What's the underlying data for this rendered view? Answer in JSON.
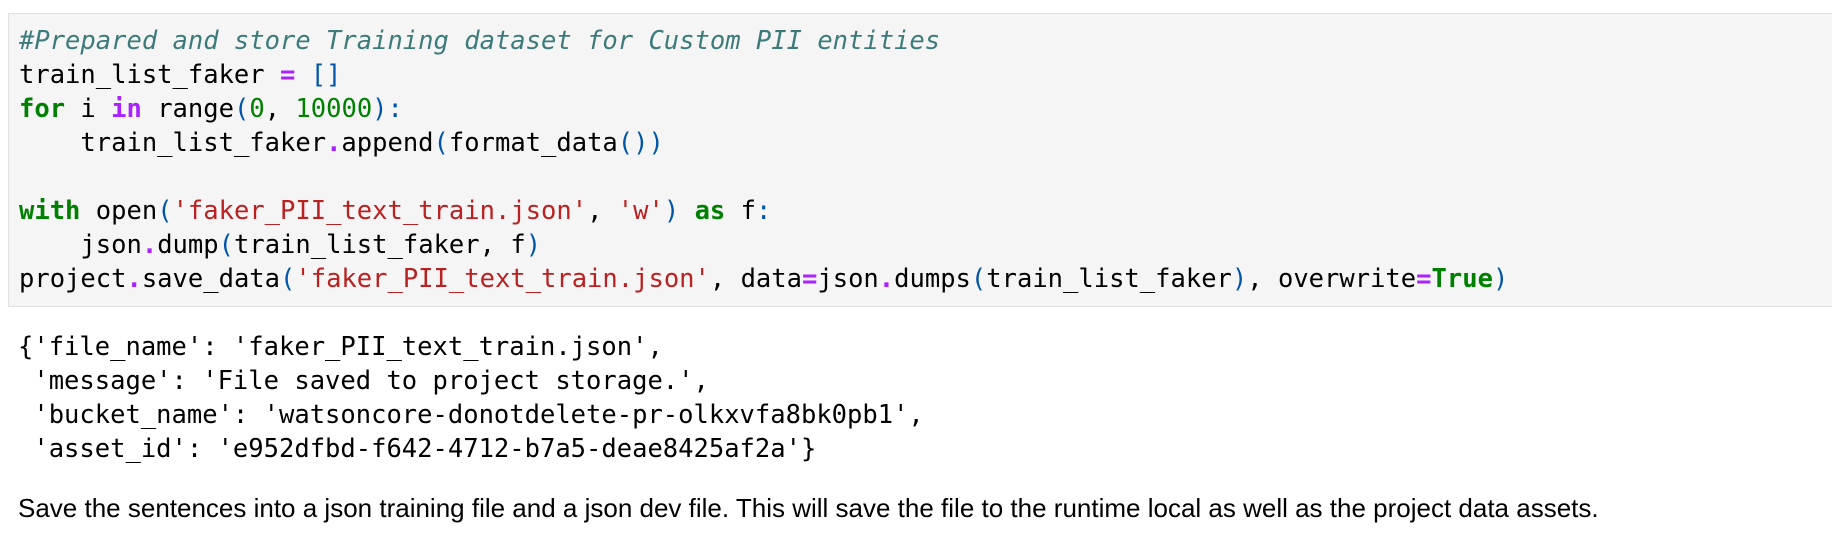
{
  "code_cell": {
    "comment": "#Prepared and store Training dataset for Custom PII entities",
    "l2": {
      "name": "train_list_faker",
      "assign": " = ",
      "value": "[]"
    },
    "l3": {
      "for": "for",
      "var": " i ",
      "in": "in",
      "call": " range",
      "open": "(",
      "n0": "0",
      "sep": ", ",
      "n1": "10000",
      "close": ")",
      "colon": ":"
    },
    "l4": {
      "indent": "    ",
      "obj": "train_list_faker",
      "dot": ".",
      "meth": "append",
      "open": "(",
      "fn": "format_data",
      "paren": "()",
      "close": ")"
    },
    "l6": {
      "with": "with",
      "sp": " ",
      "fn": "open",
      "open": "(",
      "s1": "'faker_PII_text_train.json'",
      "sep": ", ",
      "s2": "'w'",
      "close": ")",
      "sp2": " ",
      "as": "as",
      "var": " f",
      "colon": ":"
    },
    "l7": {
      "indent": "    ",
      "obj": "json",
      "dot": ".",
      "meth": "dump",
      "open": "(",
      "args": "train_list_faker, f",
      "close": ")"
    },
    "l8": {
      "obj": "project",
      "dot": ".",
      "meth": "save_data",
      "open": "(",
      "s1": "'faker_PII_text_train.json'",
      "sep": ", data",
      "eq": "=",
      "mod": "json",
      "dot2": ".",
      "fn": "dumps",
      "open2": "(",
      "arg": "train_list_faker",
      "close2": ")",
      "sep2": ", overwrite",
      "eq2": "=",
      "true": "True",
      "close": ")"
    }
  },
  "output": {
    "lines": [
      "{'file_name': 'faker_PII_text_train.json',",
      " 'message': 'File saved to project storage.',",
      " 'bucket_name': 'watsoncore-donotdelete-pr-olkxvfa8bk0pb1',",
      " 'asset_id': 'e952dfbd-f642-4712-b7a5-deae8425af2a'}"
    ]
  },
  "markdown": {
    "text": "Save the sentences into a json training file and a json dev file. This will save the file to the runtime local as well as the project data assets."
  }
}
